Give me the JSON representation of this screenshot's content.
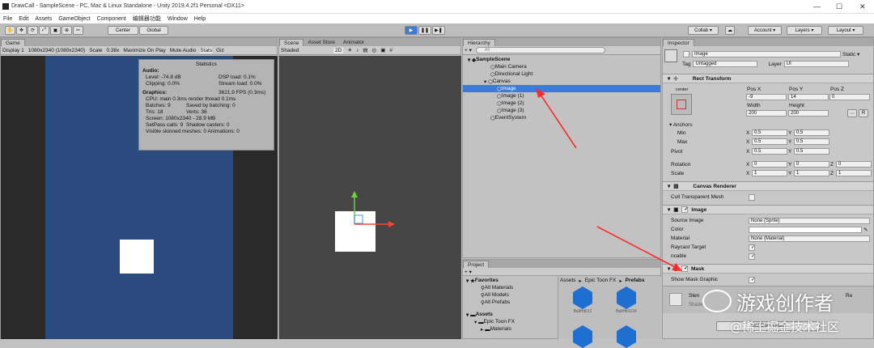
{
  "titlebar": {
    "title": "DrawCall - SampleScene - PC, Mac & Linux Standalone - Unity 2019.4.2f1 Personal <DX11>"
  },
  "menu": [
    "File",
    "Edit",
    "Assets",
    "GameObject",
    "Component",
    "编辑器功能",
    "Window",
    "Help"
  ],
  "toolbar": {
    "center": "Center",
    "global": "Global",
    "collab": "Collab ▾",
    "account": "Account ▾",
    "layers": "Layers ▾",
    "layout": "Layout ▾"
  },
  "game": {
    "tab": "Game",
    "display": "Display 1",
    "resolution": "1080x2340 (1080x2340)",
    "scale_label": "Scale",
    "scale_value": "0.38x",
    "maximize": "Maximize On Play",
    "mute": "Mute Audio",
    "stats": "Stats",
    "gizmos": "Giz"
  },
  "stats": {
    "title": "Statistics",
    "audio": "Audio:",
    "level": "Level: -74.8 dB",
    "clipping": "Clipping: 0.0%",
    "dsp": "DSP load: 0.1%",
    "stream": "Stream load: 0.0%",
    "graphics": "Graphics:",
    "fps": "3621.9 FPS (0.3ms)",
    "cpu": "CPU: main 0.3ms  render thread 0.1ms",
    "batches": "Batches: 9",
    "saved": "Saved by batching: 0",
    "tris": "Tris: 18",
    "verts": "Verts: 36",
    "screen": "Screen: 1080x2340 - 28.9 MB",
    "setpass": "SetPass calls: 9",
    "shadow": "Shadow casters: 0",
    "skinned": "Visible skinned meshes: 0  Animations: 0"
  },
  "scene": {
    "tabs": [
      "Scene",
      "Asset Store",
      "Animator"
    ],
    "shaded": "Shaded",
    "mode2d": "2D"
  },
  "hierarchy": {
    "tab": "Hierarchy",
    "create": "+ ▾",
    "search": "All",
    "items": [
      "SampleScene",
      "Main Camera",
      "Directional Light",
      "Canvas",
      "Image",
      "Image (1)",
      "Image (2)",
      "Image (3)",
      "EventSystem"
    ]
  },
  "project": {
    "tab": "Project",
    "favorites": "Favorites",
    "fav_items": [
      "All Materials",
      "All Models",
      "All Prefabs"
    ],
    "assets": "Assets",
    "asset_items": [
      "Epic Toon FX",
      "Materials"
    ],
    "breadcrumb": [
      "Assets",
      "Epic Toon FX",
      "Prefabs"
    ],
    "prefabs": [
      "BallHit512",
      "BallHit1024"
    ]
  },
  "inspector": {
    "tab": "Inspector",
    "name": "Image",
    "static": "Static ▾",
    "tag_label": "Tag",
    "tag": "Untagged",
    "layer_label": "Layer",
    "layer": "UI",
    "rect": {
      "title": "Rect Transform",
      "anchor_preset": "center",
      "posx_label": "Pos X",
      "posy_label": "Pos Y",
      "posz_label": "Pos Z",
      "posx": "-9",
      "posy": "14",
      "posz": "0",
      "width_label": "Width",
      "height_label": "Height",
      "width": "200",
      "height": "200",
      "anchors": "Anchors",
      "min": "Min",
      "max": "Max",
      "pivot": "Pivot",
      "rotation": "Rotation",
      "scale": "Scale",
      "x": "X",
      "y": "Y",
      "z": "Z",
      "half": "0.5",
      "zero": "0",
      "one": "1",
      "r_btn": "R"
    },
    "canvas_renderer": {
      "title": "Canvas Renderer",
      "cull": "Cull Transparent Mesh"
    },
    "image": {
      "title": "Image",
      "source_label": "Source Image",
      "source": "None (Sprite)",
      "color_label": "Color",
      "material_label": "Material",
      "material": "None (Material)",
      "raycast": "Raycast Target",
      "maskable": "ncable"
    },
    "mask": {
      "title": "Mask",
      "show_graphic": "Show Mask Graphic",
      "stencil": "Sten",
      "shader": "Shade",
      "re": "Re"
    },
    "add_component": "Add Component"
  },
  "watermark": {
    "title": "游戏创作者",
    "sub": "@稀土掘金技术社区"
  },
  "colors": {
    "game_bg": "#2b4a7d",
    "selection": "#3e7bd6",
    "arrow": "#ff2a2a"
  }
}
